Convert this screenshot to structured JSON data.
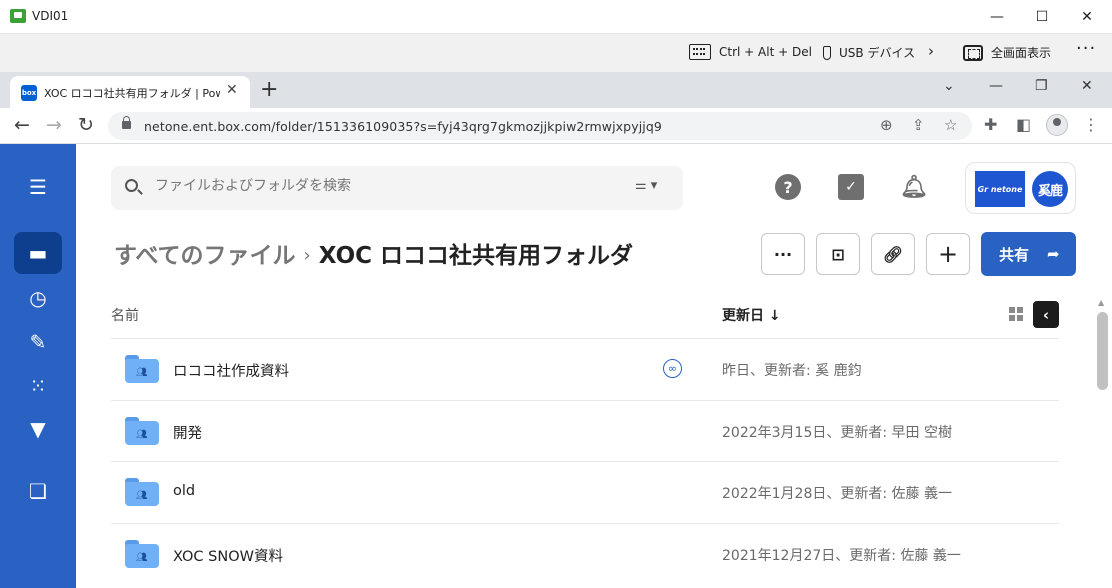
{
  "vdi": {
    "title": "VDI01",
    "toolbar": {
      "ctrl_alt_del": "Ctrl + Alt + Del",
      "usb": "USB デバイス",
      "fullscreen": "全画面表示"
    }
  },
  "browser": {
    "tab_title": "XOC ロココ社共有用フォルダ | Powe",
    "favicon_text": "box",
    "url": "netone.ent.box.com/folder/151336109035?s=fyj43qrg7gkmozjjkpiw2rmwjxpyjjq9"
  },
  "search": {
    "placeholder": "ファイルおよびフォルダを検索"
  },
  "account": {
    "brand": "Gr netone",
    "avatar": "奚鹿"
  },
  "breadcrumb": {
    "root": "すべてのファイル",
    "current": "XOC ロココ社共有用フォルダ"
  },
  "actions": {
    "share_label": "共有"
  },
  "table": {
    "col_name": "名前",
    "col_date": "更新日",
    "rows": [
      {
        "name": "ロココ社作成資料",
        "updated": "昨日、更新者: 奚 鹿鈞",
        "shared_link": true
      },
      {
        "name": "開発",
        "updated": "2022年3月15日、更新者: 早田 空樹",
        "shared_link": false
      },
      {
        "name": "old",
        "updated": "2022年1月28日、更新者: 佐藤 義一",
        "shared_link": false
      },
      {
        "name": "XOC SNOW資料",
        "updated": "2021年12月27日、更新者: 佐藤 義一",
        "shared_link": false
      }
    ]
  },
  "colors": {
    "sidebar": "#2a62c4",
    "sidebar_active": "#0e3f8f",
    "primary": "#2a62c4",
    "folder": "#6fb0f7"
  }
}
